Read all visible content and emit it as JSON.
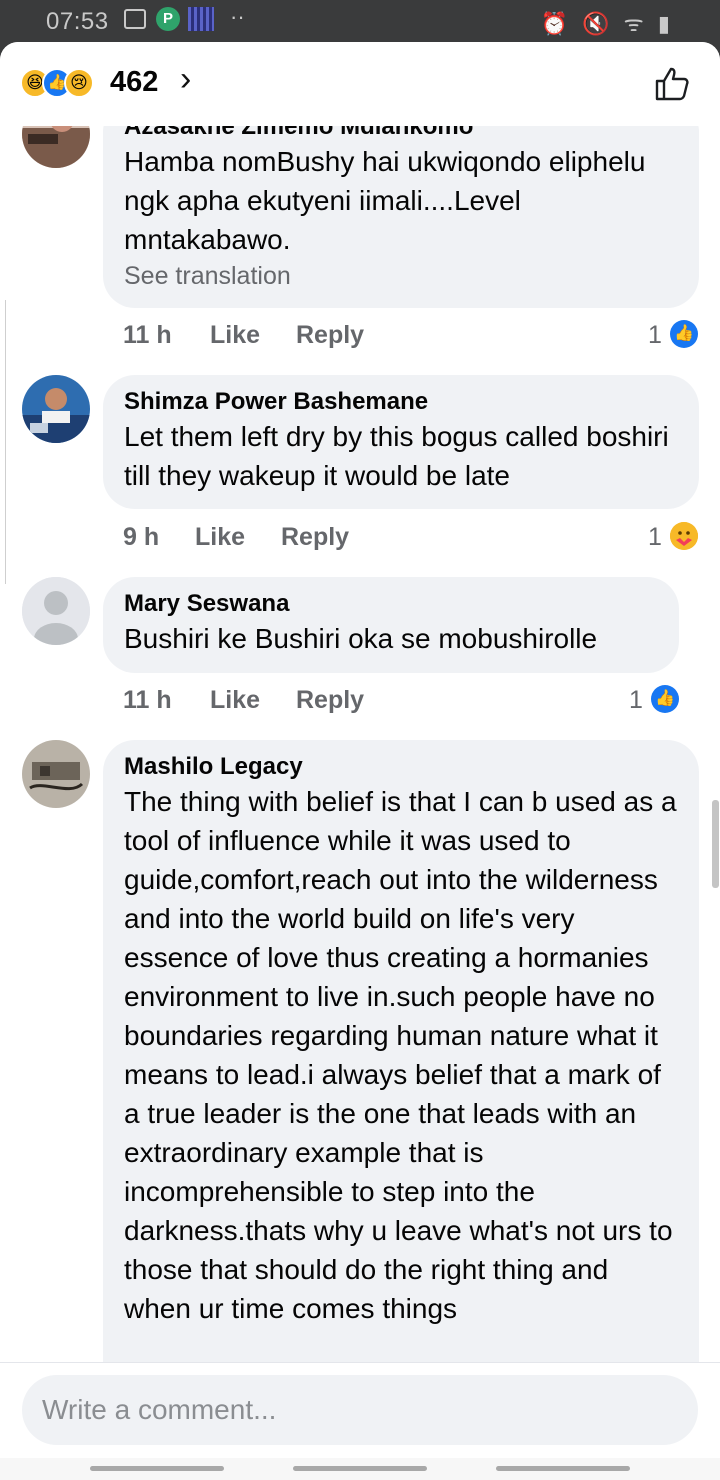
{
  "status_bar": {
    "time": "07:53",
    "left_icons": [
      "gallery-icon",
      "p-app-icon",
      "notification-image-icon",
      "more-dots-icon"
    ],
    "right_icons": [
      "alarm-icon",
      "mute-icon",
      "wifi-icon",
      "signal-icon",
      "battery-icon"
    ],
    "dots": "··",
    "right_glyphs": "⏰ 🔇 ᯤ ▮"
  },
  "header": {
    "reaction_icons": [
      "haha-reaction-icon",
      "like-reaction-icon",
      "sad-reaction-icon"
    ],
    "reaction_count": "462",
    "chevron": "›",
    "like_icon": "thumbs-up-outline-icon"
  },
  "comments": [
    {
      "name": "Azasakhe Zimemo Mdlankomo",
      "text": "Hamba nomBushy hai ukwiqondo eliphelu ngk apha ekutyeni iimali....Level mntakabawo.",
      "translation": "See translation",
      "time": "11 h",
      "like": "Like",
      "reply": "Reply",
      "reaction_count": "1",
      "reaction_icon": "like-reaction-icon"
    },
    {
      "name": "Shimza Power Bashemane",
      "text": "Let them left dry by this bogus called boshiri till they wakeup it would be late",
      "time": "9 h",
      "like": "Like",
      "reply": "Reply",
      "reaction_count": "1",
      "reaction_icon": "care-reaction-icon"
    },
    {
      "name": "Mary Seswana",
      "text": "Bushiri ke Bushiri oka se mobushirolle",
      "time": "11 h",
      "like": "Like",
      "reply": "Reply",
      "reaction_count": "1",
      "reaction_icon": "like-reaction-icon"
    },
    {
      "name": "Mashilo Legacy",
      "text": "The thing with belief is that I can b used as a tool of influence while it was used to guide,comfort,reach out into the wilderness and into the world build on life's very essence of love thus creating a hormanies environment to live in.such people have no boundaries regarding human nature what it means to lead.i always belief that a mark of a true leader is the one that leads with an extraordinary example that is incomprehensible to step into the darkness.thats why u leave what's not urs to those that should do the right thing and when ur time comes things"
    }
  ],
  "composer": {
    "placeholder": "Write a comment..."
  },
  "colors": {
    "facebook_blue": "#1877f2",
    "bubble_bg": "#f0f2f5",
    "meta_gray": "#65676b",
    "status_bar_bg": "#3a3b3c"
  }
}
